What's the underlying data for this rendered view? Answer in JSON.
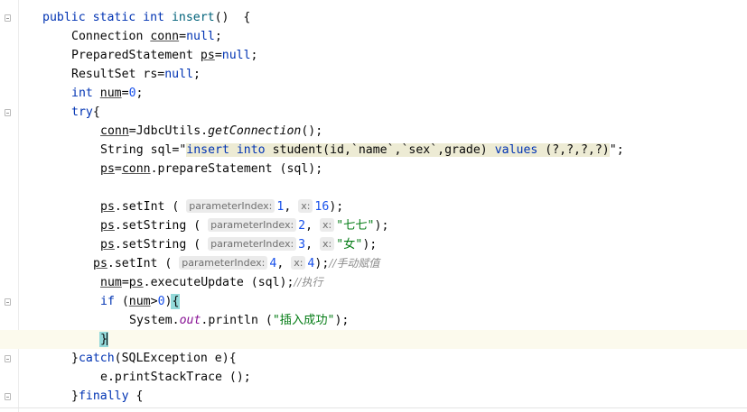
{
  "editor": {
    "l1": {
      "kw": "public static int",
      "name": "insert",
      "rest": "()  {"
    },
    "l2": {
      "type": "Connection ",
      "var": "conn",
      "eq": "=",
      "val": "null",
      "end": ";"
    },
    "l3": {
      "type": "PreparedStatement ",
      "var": "ps",
      "eq": "=",
      "val": "null",
      "end": ";"
    },
    "l4": {
      "type": "ResultSet rs=",
      "val": "null",
      "end": ";"
    },
    "l5": {
      "kw": "int",
      "sp": " ",
      "var": "num",
      "eq": "=",
      "val": "0",
      "end": ";"
    },
    "l6": {
      "kw": "try",
      "end": "{"
    },
    "l7": {
      "var": "conn",
      "eq": "=JdbcUtils.",
      "mth": "getConnection",
      "end": "();"
    },
    "l8": {
      "pre": "String sql=\"",
      "ins": "insert into",
      "mid": " student(id,`name`,`sex`,grade) ",
      "val": "values",
      "tail": " (?,?,?,?)",
      "end": "\";"
    },
    "l9": {
      "var": "ps",
      "eq": "=",
      "var2": "conn",
      "end": ".prepareStatement (sql);"
    },
    "l10": {
      "var": "ps",
      "call": ".setInt ( ",
      "hint1": "parameterIndex:",
      "a1": "1",
      "sep": ", ",
      "hint2": "x:",
      "a2": "16",
      "end": ");"
    },
    "l11": {
      "var": "ps",
      "call": ".setString ( ",
      "hint1": "parameterIndex:",
      "a1": "2",
      "sep": ", ",
      "hint2": "x:",
      "a2": "\"七七\"",
      "end": ");"
    },
    "l12": {
      "var": "ps",
      "call": ".setString ( ",
      "hint1": "parameterIndex:",
      "a1": "3",
      "sep": ", ",
      "hint2": "x:",
      "a2": "\"女\"",
      "end": ");"
    },
    "l13": {
      "var": "ps",
      "call": ".setInt ( ",
      "hint1": "parameterIndex:",
      "a1": "4",
      "sep": ", ",
      "hint2": "x:",
      "a2": "4",
      "end": ");",
      "cmt": "//手动赋值"
    },
    "l14": {
      "var": "num",
      "eq": "=",
      "var2": "ps",
      "call": ".executeUpdate (sql);",
      "cmt": "//执行"
    },
    "l15": {
      "kw": "if",
      "open": " (",
      "var": "num",
      "op": ">",
      "num": "0",
      "close": ")",
      "brace": "{"
    },
    "l16": {
      "pre": "System.",
      "fld": "out",
      "end": ".println (",
      "str": "\"插入成功\"",
      "tail": ");"
    },
    "l17": {
      "brace": "}"
    },
    "l18": {
      "pre": "}",
      "kw": "catch",
      "end": "(SQLException e){"
    },
    "l19": {
      "text": "e.printStackTrace ();"
    },
    "l20": {
      "pre": "}",
      "kw": "finally",
      "end": " {"
    }
  }
}
